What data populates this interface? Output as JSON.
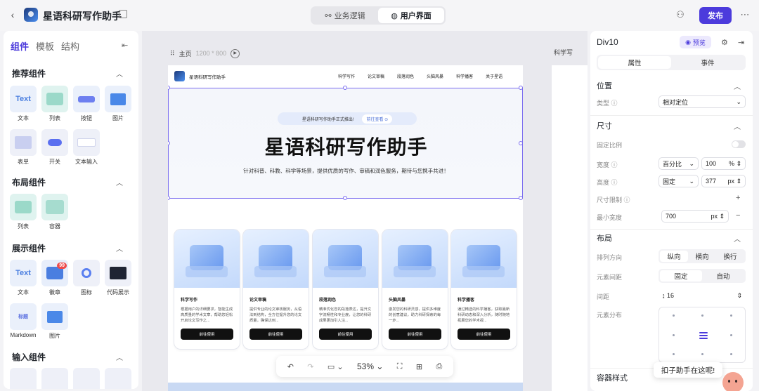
{
  "app": {
    "title": "星语科研写作助手"
  },
  "top_tabs": [
    {
      "label": "业务逻辑"
    },
    {
      "label": "用户界面"
    }
  ],
  "publish_label": "发布",
  "left_panel": {
    "tabs": [
      {
        "label": "组件"
      },
      {
        "label": "模板"
      },
      {
        "label": "结构"
      }
    ],
    "sections": {
      "recommended": {
        "title": "推荐组件",
        "items": [
          {
            "label": "文本",
            "tile": "Text"
          },
          {
            "label": "列表"
          },
          {
            "label": "按钮"
          },
          {
            "label": "图片"
          },
          {
            "label": "表单"
          },
          {
            "label": "开关"
          },
          {
            "label": "文本输入"
          }
        ]
      },
      "layout": {
        "title": "布局组件",
        "items": [
          {
            "label": "列表"
          },
          {
            "label": "容器"
          }
        ]
      },
      "display": {
        "title": "展示组件",
        "items": [
          {
            "label": "文本",
            "tile": "Text"
          },
          {
            "label": "徽章",
            "badge": "99"
          },
          {
            "label": "图标"
          },
          {
            "label": "代码展示"
          },
          {
            "label": "Markdown",
            "tile": "标题"
          },
          {
            "label": "图片"
          }
        ]
      },
      "input": {
        "title": "输入组件"
      }
    }
  },
  "canvas": {
    "breadcrumb": {
      "page": "主页",
      "size": "1200 * 800"
    },
    "breadcrumb2": "科学写",
    "page": {
      "brand": "星语科研写作助手",
      "nav": [
        "科学写作",
        "论文审稿",
        "段落润色",
        "头脑风暴",
        "科学播客",
        "关于星语"
      ],
      "pill": {
        "text": "星语科研写作助手正式推出!",
        "link": "前往查看 ⊙"
      },
      "hero_title": "星语科研写作助手",
      "hero_subtitle": "针对科普、科教、科学等场景，提供优质的写作、审稿和润色服务，期待与您携手共进！",
      "cards": [
        {
          "title": "科学写作",
          "desc": "根据用户的详细要求，智能生成高质量的学术文章，帮助您轻松开启论文写作之...",
          "button": "前往使用"
        },
        {
          "title": "论文审稿",
          "desc": "提供专业的论文审核服务，从语法到结构，全方位提升您的论文质量，确保达到...",
          "button": "前往使用"
        },
        {
          "title": "段落润色",
          "desc": "精准优化您的段落表达，提升文字流畅性和专业度，让您的科研成果更加引人注...",
          "button": "前往使用"
        },
        {
          "title": "头脑风暴",
          "desc": "激发您的科研灵感，提供多维度的创意建议，助力科研探索的每一步...",
          "button": "前往使用"
        },
        {
          "title": "科学播客",
          "desc": "通过精选的科学播客，获取最新科研动态和深入分析，随时随地拓展您的学术视...",
          "button": "前往使用"
        }
      ]
    },
    "zoom": "53%"
  },
  "right_panel": {
    "element_name": "Div10",
    "preview_label": "预览",
    "tabs": [
      {
        "label": "属性"
      },
      {
        "label": "事件"
      }
    ],
    "position": {
      "title": "位置",
      "type_label": "类型",
      "type_value": "相对定位"
    },
    "size": {
      "title": "尺寸",
      "fixed_ratio_label": "固定比例",
      "width_label": "宽度",
      "width_mode": "百分比",
      "width_value": "100",
      "width_unit": "%",
      "height_label": "高度",
      "height_mode": "固定",
      "height_value": "377",
      "height_unit": "px",
      "limit_label": "尺寸限制",
      "min_width_label": "最小宽度",
      "min_width_value": "700",
      "min_width_unit": "px"
    },
    "layout": {
      "title": "布局",
      "direction_label": "排列方向",
      "direction_options": [
        "纵向",
        "横向",
        "换行"
      ],
      "spacing_label": "元素间距",
      "spacing_options": [
        "固定",
        "自动"
      ],
      "gap_label": "间距",
      "gap_value": "16",
      "distribution_label": "元素分布"
    },
    "container_style": {
      "title": "容器样式"
    }
  },
  "assistant_tip": "扣子助手在这呢!"
}
